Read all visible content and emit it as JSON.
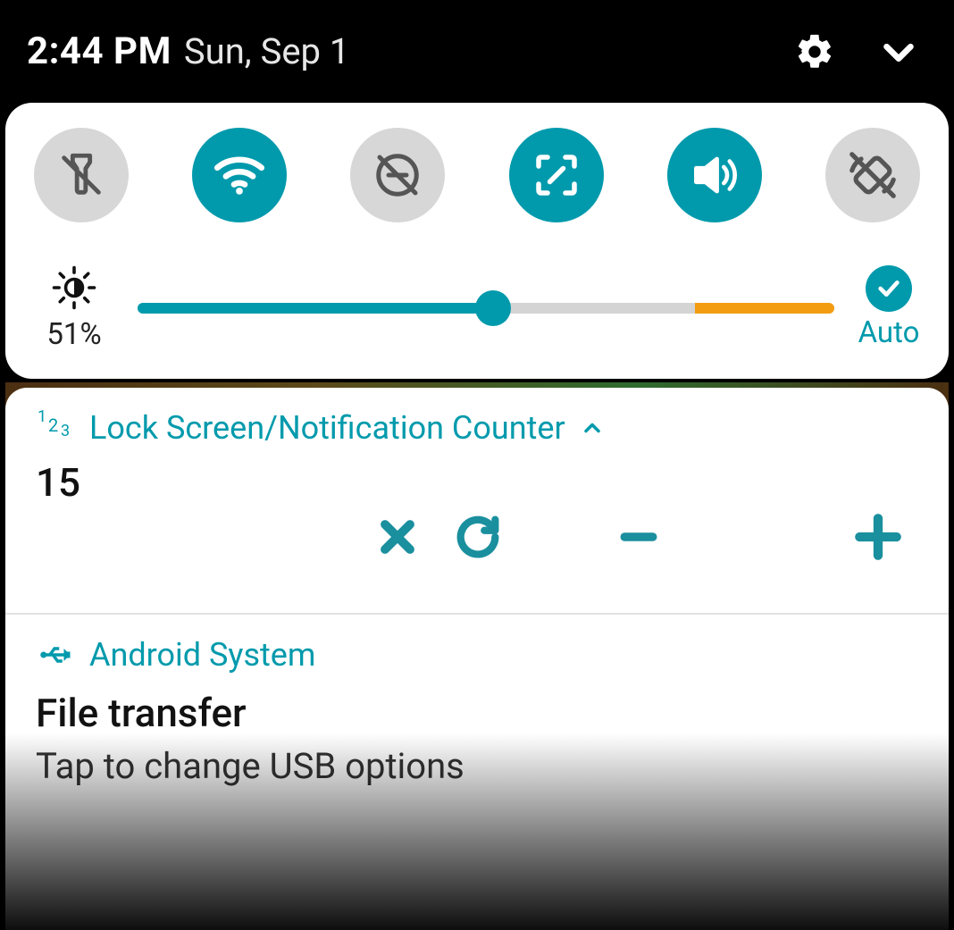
{
  "status": {
    "time": "2:44 PM",
    "date": "Sun, Sep 1"
  },
  "quick_settings": {
    "tiles": [
      {
        "name": "flashlight",
        "active": false
      },
      {
        "name": "wifi",
        "active": true
      },
      {
        "name": "dnd",
        "active": false
      },
      {
        "name": "screenshot",
        "active": true
      },
      {
        "name": "sound",
        "active": true
      },
      {
        "name": "autorotate",
        "active": false
      }
    ],
    "brightness": {
      "percent_label": "51%",
      "value": 51,
      "warn_start_pct": 80,
      "auto_label": "Auto",
      "auto_on": true
    }
  },
  "notifications": [
    {
      "app": "Lock Screen/Notification Counter",
      "icon": "123",
      "expanded": true,
      "count": "15",
      "actions": [
        "close",
        "reset",
        "minus",
        "plus"
      ]
    },
    {
      "app": "Android System",
      "icon": "usb",
      "title": "File transfer",
      "subtitle": "Tap to change USB options"
    }
  ],
  "colors": {
    "accent": "#009aac",
    "tile_off": "#d7d7d7",
    "warn": "#f39c12"
  }
}
